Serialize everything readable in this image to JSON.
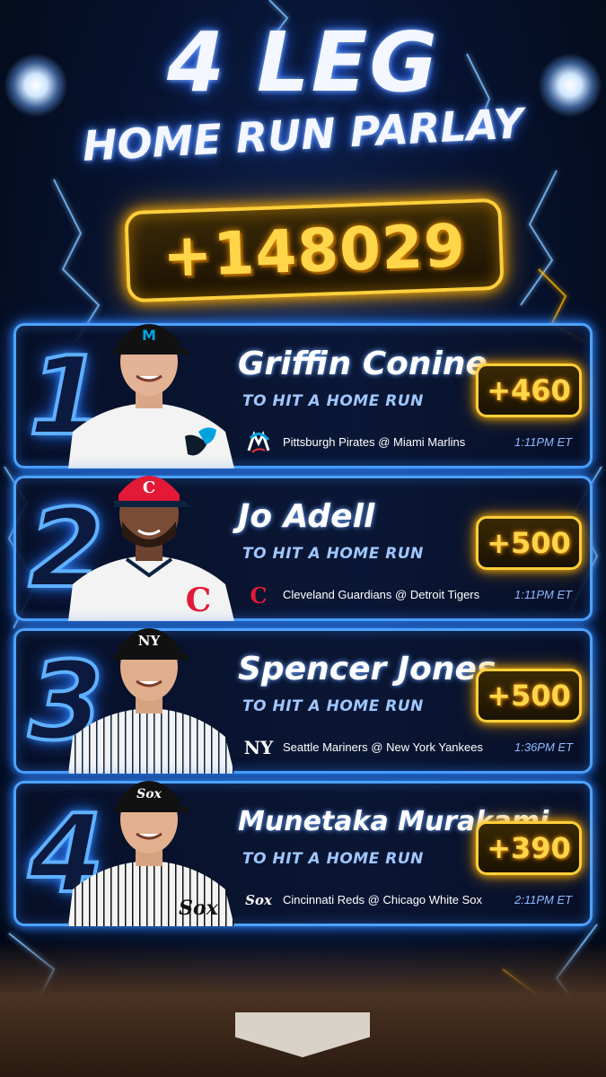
{
  "header": {
    "title_line1": "4 LEG",
    "title_line2": "HOME RUN PARLAY",
    "total_odds": "+148029"
  },
  "legs": [
    {
      "number": "1",
      "player": "Griffin Conine",
      "bet": "TO HIT A HOME RUN",
      "odds": "+460",
      "matchup": "Pittsburgh Pirates @ Miami Marlins",
      "time": "1:11PM ET",
      "team_logo": "marlins-logo",
      "cap_letter": "M",
      "jersey": "white"
    },
    {
      "number": "2",
      "player": "Jo Adell",
      "bet": "TO HIT A HOME RUN",
      "odds": "+500",
      "matchup": "Cleveland Guardians @ Detroit Tigers",
      "time": "1:11PM ET",
      "team_logo": "guardians-logo",
      "cap_letter": "C",
      "jersey": "white"
    },
    {
      "number": "3",
      "player": "Spencer Jones",
      "bet": "TO HIT A HOME RUN",
      "odds": "+500",
      "matchup": "Seattle Mariners @ New York Yankees",
      "time": "1:36PM ET",
      "team_logo": "yankees-logo",
      "cap_letter": "NY",
      "jersey": "pinstripe"
    },
    {
      "number": "4",
      "player": "Munetaka Murakami",
      "bet": "TO HIT A HOME RUN",
      "odds": "+390",
      "matchup": "Cincinnati Reds @ Chicago White Sox",
      "time": "2:11PM ET",
      "team_logo": "white-sox-logo",
      "cap_letter": "Sox",
      "jersey": "pinstripe"
    }
  ],
  "colors": {
    "accent_blue": "#4da3ff",
    "gold": "#ffcf3a",
    "marlins_teal": "#00a3e0",
    "guardians_red": "#e31937",
    "navy": "#0c2340"
  }
}
